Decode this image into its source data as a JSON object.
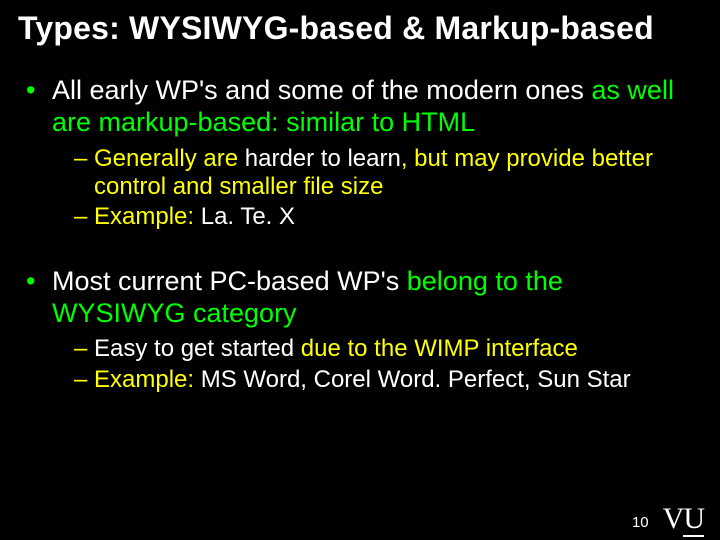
{
  "title": "Types: WYSIWYG-based & Markup-based",
  "bullets": [
    {
      "pre": "All early WP's and some of the modern ones",
      "post": " as well are markup-based:  similar to HTML",
      "subs": [
        {
          "pre": "Generally are ",
          "hl": "harder to learn",
          "post": ", but may provide better control and smaller file size"
        },
        {
          "pre": "Example: ",
          "hl": "La. Te. X",
          "post": ""
        }
      ]
    },
    {
      "pre": "Most current PC-based WP's",
      "post": " belong to the WYSIWYG category",
      "subs": [
        {
          "pre": "Easy to get started",
          "hl": "",
          "post": " due to the WIMP interface"
        },
        {
          "pre": "Example: ",
          "hl": "MS Word, Corel Word. Perfect, Sun Star",
          "post": ""
        }
      ]
    }
  ],
  "page_number": "10",
  "logo": {
    "left": "V",
    "right": "U"
  }
}
